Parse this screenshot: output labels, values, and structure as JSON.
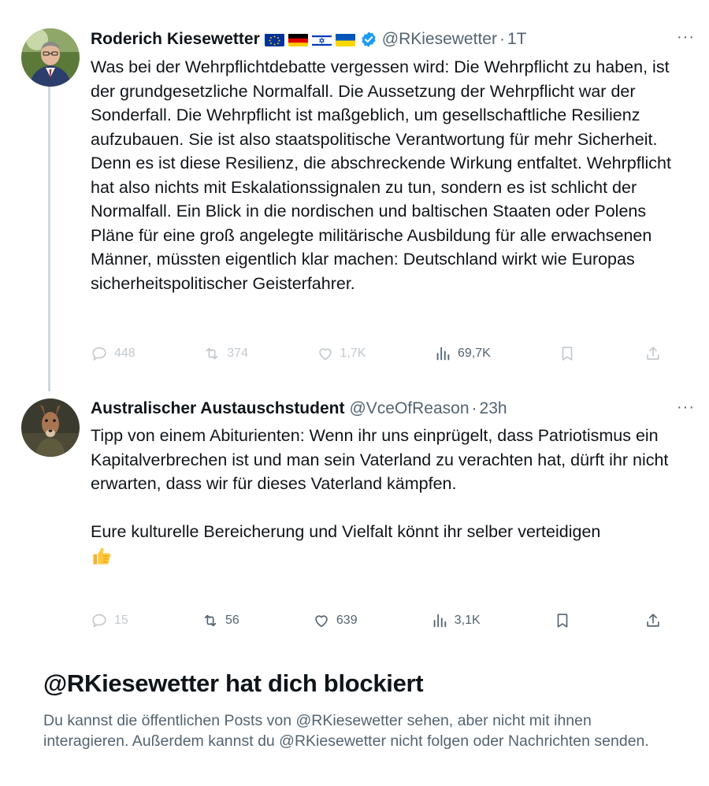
{
  "tweet1": {
    "author_name": "Roderich Kiesewetter",
    "flags": [
      "eu-flag",
      "germany-flag",
      "israel-flag",
      "ukraine-flag"
    ],
    "handle": "@RKiesewetter",
    "separator": "·",
    "time": "1T",
    "more": "···",
    "text": "Was bei der Wehrpflichtdebatte vergessen wird: Die Wehrpflicht zu haben, ist der grundgesetzliche Normalfall. Die Aussetzung der Wehrpflicht war der Sonderfall. Die Wehrpflicht ist maßgeblich, um gesellschaftliche Resilienz aufzubauen. Sie ist also staatspolitische Verantwortung für mehr Sicherheit. Denn es ist diese Resilienz, die abschreckende Wirkung entfaltet. Wehrpflicht hat also nichts mit Eskalationssignalen zu tun, sondern es ist schlicht der Normalfall. Ein Blick in die nordischen und baltischen Staaten oder Polens Pläne für eine groß angelegte militärische Ausbildung für alle erwachsenen Männer, müssten eigentlich klar machen: Deutschland wirkt wie Europas sicherheitspolitischer Geisterfahrer.",
    "replies": "448",
    "reposts": "374",
    "likes": "1,7K",
    "views": "69,7K"
  },
  "tweet2": {
    "author_name": "Australischer Austauschstudent",
    "handle": "@VceOfReason",
    "separator": "·",
    "time": "23h",
    "more": "···",
    "text_p1": "Tipp von einem Abiturienten: Wenn ihr uns einprügelt, dass Patriotismus ein Kapitalverbrechen ist und man sein Vaterland zu verachten hat, dürft ihr nicht erwarten, dass wir für dieses Vaterland kämpfen.",
    "text_p2": "Eure kulturelle Bereicherung und Vielfalt könnt ihr selber verteidigen",
    "emoji": "👍",
    "replies": "15",
    "reposts": "56",
    "likes": "639",
    "views": "3,1K"
  },
  "blocked": {
    "title": "@RKiesewetter hat dich blockiert",
    "message": "Du kannst die öffentlichen Posts von @RKiesewetter sehen, aber nicht mit ihnen interagieren. Außerdem kannst du @RKiesewetter nicht folgen oder Nachrichten senden."
  },
  "colors": {
    "text": "#0f1419",
    "secondary": "#536471",
    "verified": "#1d9bf0",
    "thread_line": "#cfd9de"
  }
}
